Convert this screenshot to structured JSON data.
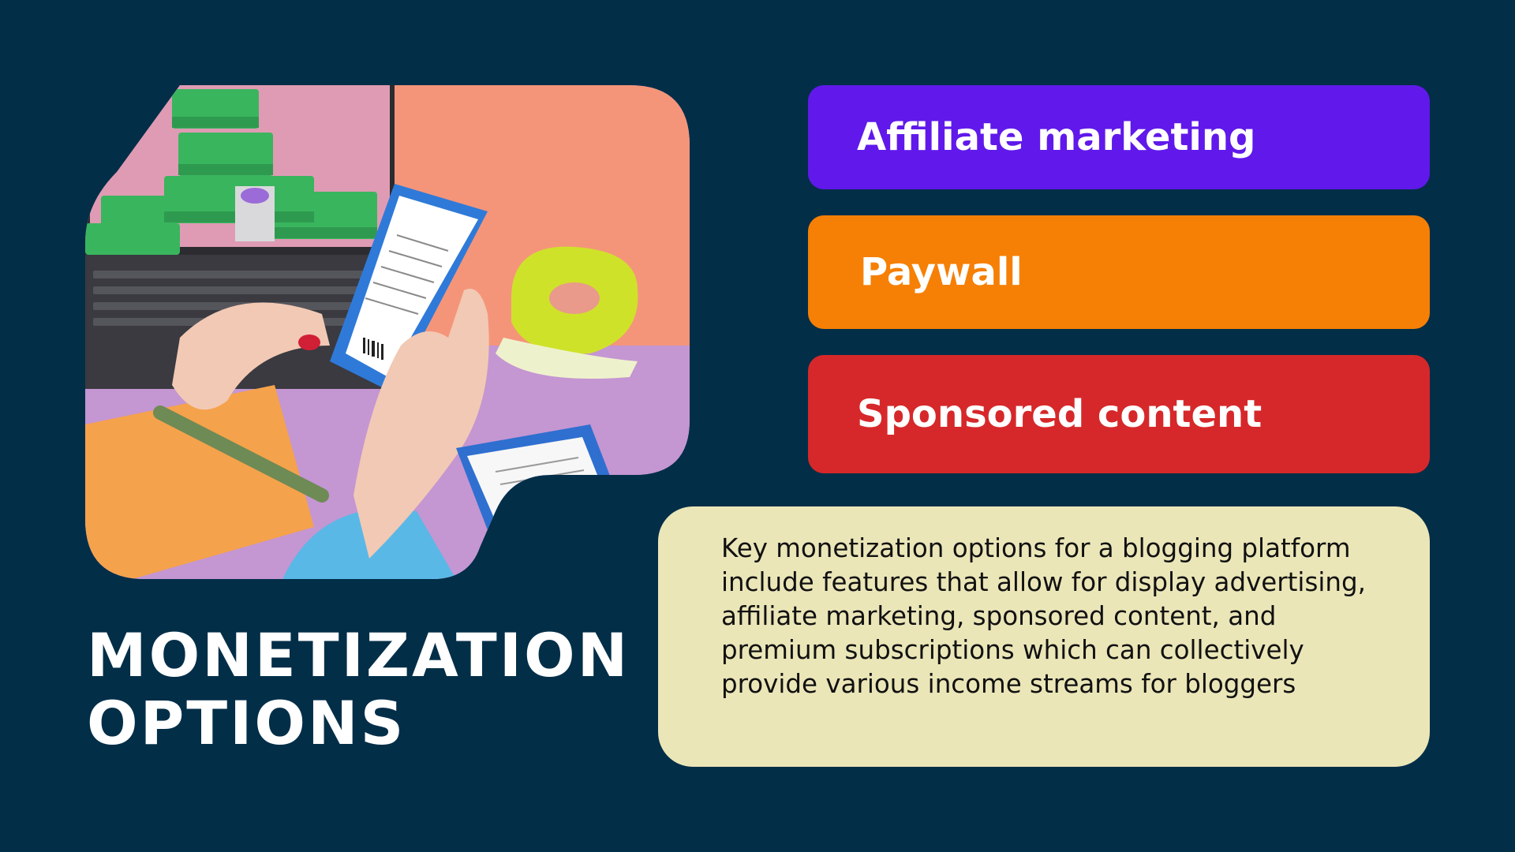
{
  "slide": {
    "title": "MONETIZATION\nOPTIONS",
    "background_color": "#022e48",
    "photo": {
      "subject": "hands-holding-receipt-photo"
    },
    "options": [
      {
        "label": "Affiliate marketing",
        "color": "#6019ea"
      },
      {
        "label": "Paywall",
        "color": "#f58005"
      },
      {
        "label": "Sponsored content",
        "color": "#d6282a"
      }
    ],
    "description": {
      "text": "Key monetization options for a blogging platform include features that allow for display advertising, affiliate marketing, sponsored content, and premium subscriptions which can collectively provide various income streams for bloggers",
      "background_color": "#ebe6b8"
    }
  }
}
